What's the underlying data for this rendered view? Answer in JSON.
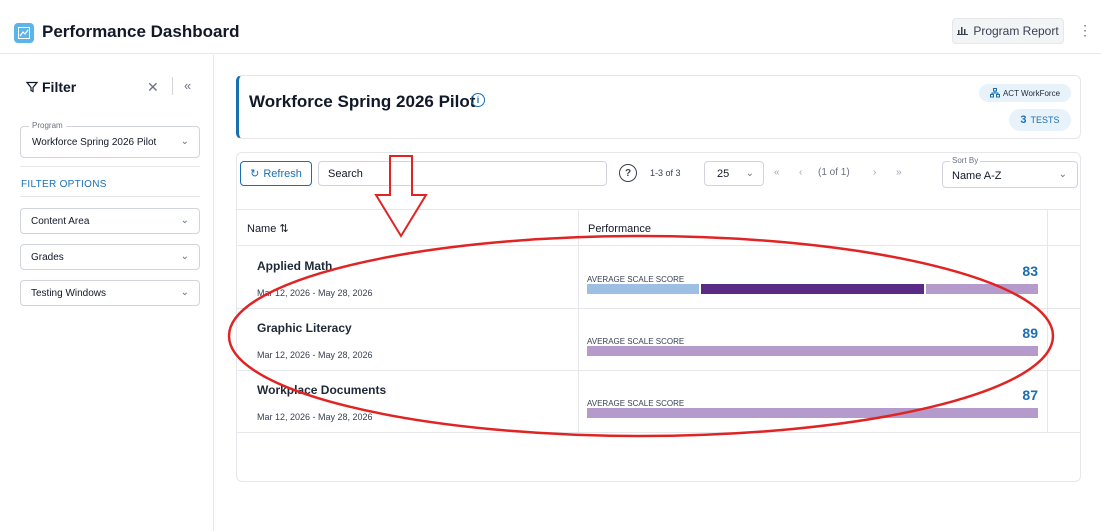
{
  "app": {
    "title": "Performance Dashboard",
    "logo_icon": "chart-line-icon",
    "report_button": "Program Report",
    "report_icon": "bar-chart-icon"
  },
  "sidebar": {
    "title": "Filter",
    "program": {
      "legend": "Program",
      "value": "Workforce Spring 2026 Pilot"
    },
    "filter_options_label": "FILTER OPTIONS",
    "dropdowns": [
      "Content Area",
      "Grades",
      "Testing Windows"
    ]
  },
  "header": {
    "title": "Workforce Spring 2026 Pilot",
    "tag": "ACT WorkForce",
    "tests_count": "3",
    "tests_label": "TESTS"
  },
  "toolbar": {
    "refresh_label": "Refresh",
    "search_placeholder": "Search",
    "range_text": "1-3 of 3",
    "page_size": "25",
    "page_info": "(1 of 1)",
    "sort_legend": "Sort By",
    "sort_value": "Name A-Z"
  },
  "table": {
    "columns": [
      "Name",
      "Performance"
    ],
    "rows": [
      {
        "name": "Applied Math",
        "date": "Mar 12, 2026 - May 28, 2026",
        "metric": "AVERAGE SCALE SCORE",
        "score": "83",
        "segments": [
          {
            "share": 0.25,
            "color": "#9dbfe3"
          },
          {
            "share": 0.5,
            "color": "#5a2b86"
          },
          {
            "share": 0.25,
            "color": "#b59bcb"
          }
        ]
      },
      {
        "name": "Graphic Literacy",
        "date": "Mar 12, 2026 - May 28, 2026",
        "metric": "AVERAGE SCALE SCORE",
        "score": "89",
        "segments": [
          {
            "share": 1.0,
            "color": "#b59bcb"
          }
        ]
      },
      {
        "name": "Workplace Documents",
        "date": "Mar 12, 2026 - May 28, 2026",
        "metric": "AVERAGE SCALE SCORE",
        "score": "87",
        "segments": [
          {
            "share": 1.0,
            "color": "#b59bcb"
          }
        ]
      }
    ]
  },
  "colors": {
    "accent": "#1a6fb0",
    "annotation": "#e02424"
  }
}
